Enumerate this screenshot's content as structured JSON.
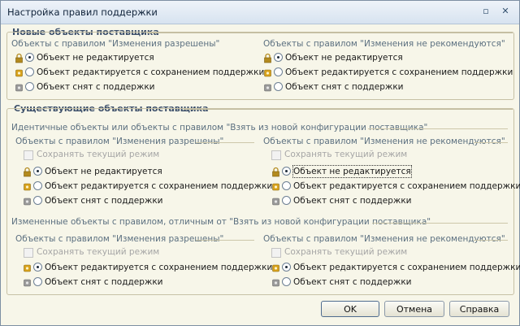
{
  "window": {
    "title": "Настройка правил поддержки"
  },
  "new_objects": {
    "title": "Новые объекты поставщика",
    "allowed": {
      "title": "Объекты с правилом \"Изменения разрешены\"",
      "options": [
        "Объект не редактируется",
        "Объект редактируется с сохранением поддержки",
        "Объект снят с поддержки"
      ],
      "selected": 0
    },
    "not_recommended": {
      "title": "Объекты с правилом \"Изменения не рекомендуются\"",
      "options": [
        "Объект не редактируется",
        "Объект редактируется с сохранением поддержки",
        "Объект снят с поддержки"
      ],
      "selected": 0
    }
  },
  "existing_objects": {
    "title": "Существующие объекты поставщика",
    "identical": {
      "title": "Идентичные объекты или объекты с правилом \"Взять из новой конфигурации поставщика\"",
      "allowed": {
        "title": "Объекты с правилом \"Изменения разрешены\"",
        "keep_mode": "Сохранять текущий режим",
        "options": [
          "Объект не редактируется",
          "Объект редактируется с сохранением поддержки",
          "Объект снят с поддержки"
        ],
        "selected": 0
      },
      "not_recommended": {
        "title": "Объекты с правилом \"Изменения не рекомендуются\"",
        "keep_mode": "Сохранять текущий режим",
        "options": [
          "Объект не редактируется",
          "Объект редактируется с сохранением поддержки",
          "Объект снят с поддержки"
        ],
        "selected": 0
      }
    },
    "changed": {
      "title": "Измененные объекты с правилом, отличным от \"Взять из новой конфигурации поставщика\"",
      "allowed": {
        "title": "Объекты с правилом \"Изменения разрешены\"",
        "keep_mode": "Сохранять текущий режим",
        "options": [
          "Объект редактируется с сохранением поддержки",
          "Объект снят с поддержки"
        ],
        "selected": 0
      },
      "not_recommended": {
        "title": "Объекты с правилом \"Изменения не рекомендуются\"",
        "keep_mode": "Сохранять текущий режим",
        "options": [
          "Объект редактируется с сохранением поддержки",
          "Объект снят с поддержки"
        ],
        "selected": 0
      }
    }
  },
  "buttons": {
    "ok": "OK",
    "cancel": "Отмена",
    "help": "Справка"
  },
  "colors": {
    "lock": "#b38a1e",
    "gear_gold": "#d8a21c",
    "gear_grey": "#9a9a9a"
  }
}
